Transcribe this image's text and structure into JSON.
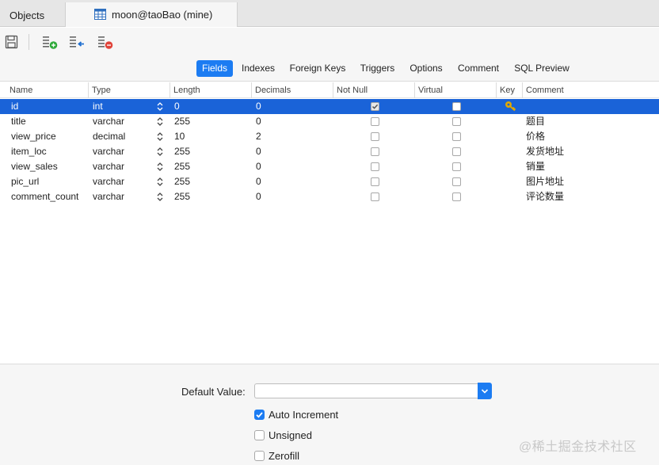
{
  "tabs": {
    "objects_label": "Objects",
    "table_label": "moon@taoBao (mine)"
  },
  "toolbar": {
    "icons": [
      "save-icon",
      "add-field-icon",
      "insert-field-icon",
      "delete-field-icon"
    ]
  },
  "segments": [
    {
      "label": "Fields",
      "active": true
    },
    {
      "label": "Indexes"
    },
    {
      "label": "Foreign Keys"
    },
    {
      "label": "Triggers"
    },
    {
      "label": "Options"
    },
    {
      "label": "Comment"
    },
    {
      "label": "SQL Preview"
    }
  ],
  "columns": [
    "Name",
    "Type",
    "Length",
    "Decimals",
    "Not Null",
    "Virtual",
    "Key",
    "Comment"
  ],
  "rows": [
    {
      "name": "id",
      "type": "int",
      "length": "0",
      "decimals": "0",
      "not_null": true,
      "virtual": false,
      "key": true,
      "comment": ""
    },
    {
      "name": "title",
      "type": "varchar",
      "length": "255",
      "decimals": "0",
      "not_null": false,
      "virtual": false,
      "key": false,
      "comment": "题目"
    },
    {
      "name": "view_price",
      "type": "decimal",
      "length": "10",
      "decimals": "2",
      "not_null": false,
      "virtual": false,
      "key": false,
      "comment": "价格"
    },
    {
      "name": "item_loc",
      "type": "varchar",
      "length": "255",
      "decimals": "0",
      "not_null": false,
      "virtual": false,
      "key": false,
      "comment": "发货地址"
    },
    {
      "name": "view_sales",
      "type": "varchar",
      "length": "255",
      "decimals": "0",
      "not_null": false,
      "virtual": false,
      "key": false,
      "comment": "销量"
    },
    {
      "name": "pic_url",
      "type": "varchar",
      "length": "255",
      "decimals": "0",
      "not_null": false,
      "virtual": false,
      "key": false,
      "comment": "图片地址"
    },
    {
      "name": "comment_count",
      "type": "varchar",
      "length": "255",
      "decimals": "0",
      "not_null": false,
      "virtual": false,
      "key": false,
      "comment": "评论数量"
    }
  ],
  "bottom": {
    "default_value_label": "Default Value:",
    "default_value": "",
    "auto_increment_label": "Auto Increment",
    "auto_increment": true,
    "unsigned_label": "Unsigned",
    "unsigned": false,
    "zerofill_label": "Zerofill",
    "zerofill": false
  },
  "watermark": "@稀土掘金技术社区",
  "colors": {
    "accent": "#1c7cf2",
    "selection": "#1a63d8",
    "key": "#e0a800"
  }
}
